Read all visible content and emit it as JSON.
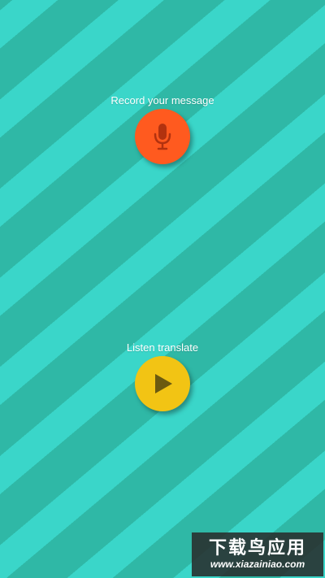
{
  "record": {
    "label": "Record your message",
    "button_icon": "microphone-icon",
    "button_color": "#ff5a1f"
  },
  "listen": {
    "label": "Listen translate",
    "button_icon": "play-icon",
    "button_color": "#f2c414"
  },
  "background": {
    "stripe_light": "#3ad6c9",
    "stripe_dark": "#2fb8a6"
  },
  "watermark": {
    "title": "下载鸟应用",
    "url": "www.xiazainiao.com"
  }
}
